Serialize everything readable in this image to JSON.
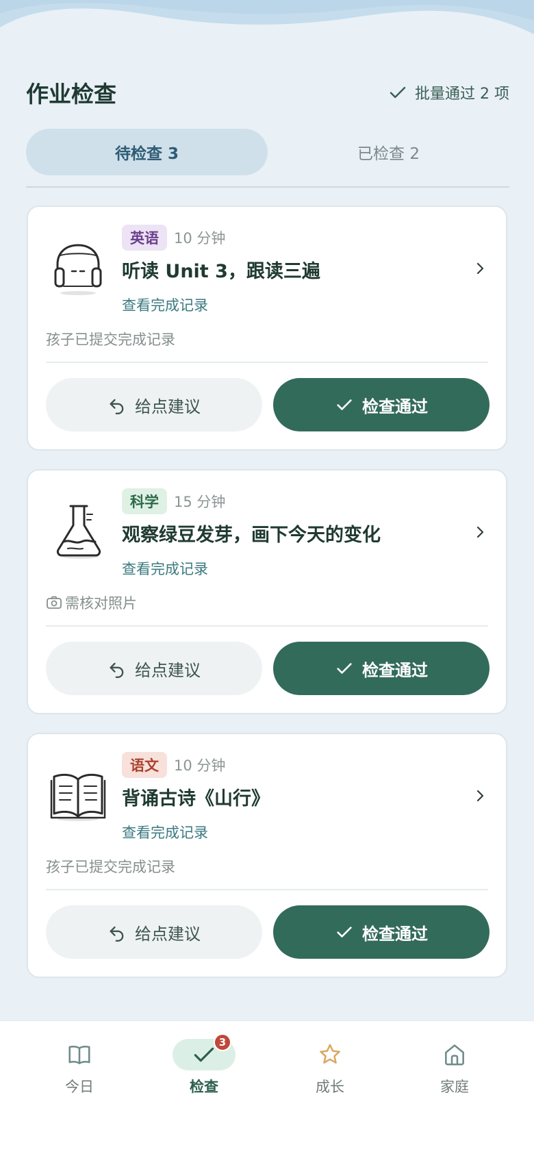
{
  "header": {
    "title": "作业检查",
    "batch_label": "批量通过 2 项"
  },
  "tabs": [
    {
      "label": "待检查 3",
      "active": true
    },
    {
      "label": "已检查 2",
      "active": false
    }
  ],
  "tasks": [
    {
      "subject": "英语",
      "duration": "10 分钟",
      "title": "听读 Unit 3，跟读三遍",
      "record_link": "查看完成记录",
      "status": "孩子已提交完成记录",
      "icon": "headphones-icon",
      "suggest_label": "给点建议",
      "pass_label": "检查通过"
    },
    {
      "subject": "科学",
      "duration": "15 分钟",
      "title": "观察绿豆发芽，画下今天的变化",
      "record_link": "查看完成记录",
      "status": "需核对照片",
      "icon": "flask-icon",
      "suggest_label": "给点建议",
      "pass_label": "检查通过"
    },
    {
      "subject": "语文",
      "duration": "10 分钟",
      "title": "背诵古诗《山行》",
      "record_link": "查看完成记录",
      "status": "孩子已提交完成记录",
      "icon": "open-book-icon",
      "suggest_label": "给点建议",
      "pass_label": "检查通过"
    }
  ],
  "nav": [
    {
      "label": "今日",
      "icon": "book-icon",
      "active": false
    },
    {
      "label": "检查",
      "icon": "check-icon",
      "active": true,
      "badge": "3"
    },
    {
      "label": "成长",
      "icon": "star-icon",
      "active": false
    },
    {
      "label": "家庭",
      "icon": "home-icon",
      "active": false
    }
  ],
  "colors": {
    "primary": "#336b5a",
    "background": "#e9f0f6",
    "active_tab": "#cfe0ea",
    "badge": "#c0473a",
    "star": "#d9a860"
  }
}
